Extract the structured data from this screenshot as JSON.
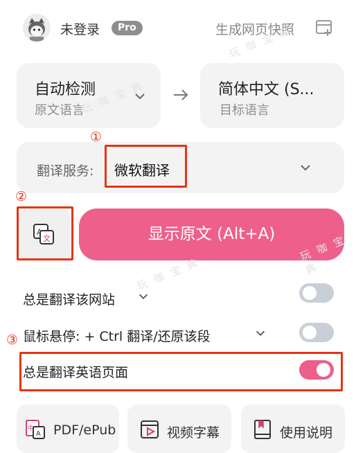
{
  "header": {
    "user_name": "未登录",
    "pro_badge": "Pro",
    "snapshot_label": "生成网页快照"
  },
  "languages": {
    "source": {
      "value": "自动检测",
      "caption": "原文语言"
    },
    "target": {
      "value": "简体中文 (S...",
      "caption": "目标语言"
    }
  },
  "service": {
    "label": "翻译服务:",
    "value": "微软翻译"
  },
  "main_button": {
    "label": "显示原文 (Alt+A)"
  },
  "toggles": [
    {
      "label": "总是翻译该网站",
      "state": "off"
    },
    {
      "label": "鼠标悬停:  + Ctrl 翻译/还原该段",
      "state": "off"
    },
    {
      "label": "总是翻译英语页面",
      "state": "on"
    }
  ],
  "tools": [
    {
      "label": "PDF/ePub",
      "icon": "pdf-translate-icon"
    },
    {
      "label": "视频字幕",
      "icon": "video-subtitle-icon"
    },
    {
      "label": "使用说明",
      "icon": "manual-book-icon"
    }
  ],
  "annotations": [
    "①",
    "②",
    "③"
  ],
  "watermark": "玩 咖 宝 典",
  "colors": {
    "accent_pink": "#ee5f8c",
    "annotation_red": "#e63312",
    "panel_gray": "#f3f3f3"
  }
}
